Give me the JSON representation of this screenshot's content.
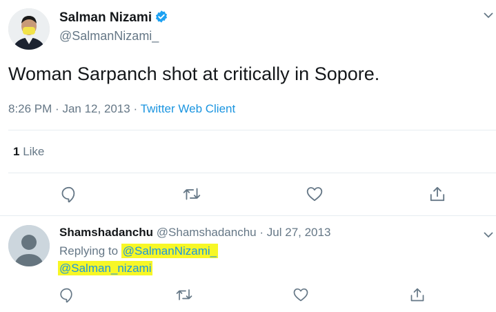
{
  "tweet": {
    "author_name": "Salman Nizami",
    "author_handle": "@SalmanNizami_",
    "text": "Woman Sarpanch shot at critically in Sopore.",
    "time": "8:26 PM",
    "separator": "·",
    "date": "Jan 12, 2013",
    "source": "Twitter Web Client",
    "likes_count": "1",
    "likes_label": "Like"
  },
  "reply": {
    "author_name": "Shamshadanchu",
    "author_handle": "@Shamshadanchu",
    "separator": "·",
    "date": "Jul 27, 2013",
    "replying_prefix": "Replying to",
    "mention_1": "@SalmanNizami_",
    "mention_2": "@Salman_nizami"
  },
  "icons": {
    "verified": "verified-badge-icon",
    "menu": "chevron-down-icon",
    "reply": "reply-icon",
    "retweet": "retweet-icon",
    "like": "heart-icon",
    "share": "share-icon"
  },
  "colors": {
    "link": "#1b95e0",
    "highlight": "#f7f726",
    "secondary_text": "#657786",
    "verified": "#1da1f2"
  }
}
